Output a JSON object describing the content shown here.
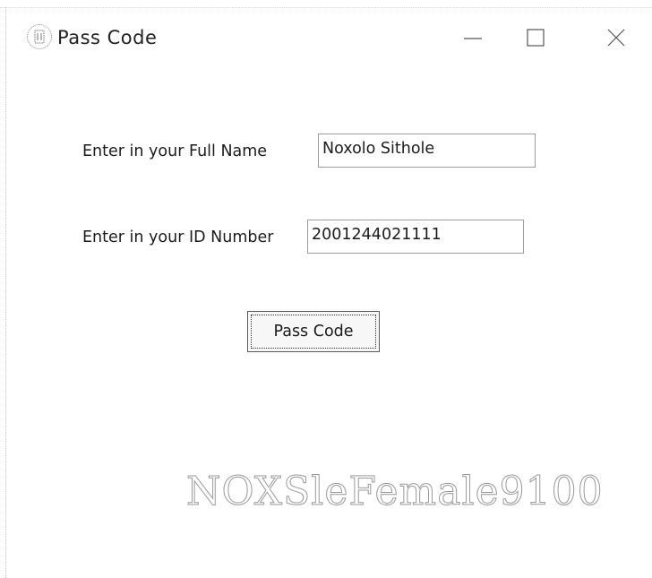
{
  "window": {
    "title": "Pass Code",
    "icon": "app-logo-icon",
    "controls": [
      "minimize-icon",
      "maximize-icon",
      "close-icon"
    ]
  },
  "form": {
    "full_name_label": "Enter in your Full Name",
    "full_name_value": "Noxolo Sithole",
    "id_number_label": "Enter in your ID Number",
    "id_number_value": "2001244021111",
    "submit_label": "Pass Code"
  },
  "result": {
    "code": "NOXSleFemale9100"
  }
}
